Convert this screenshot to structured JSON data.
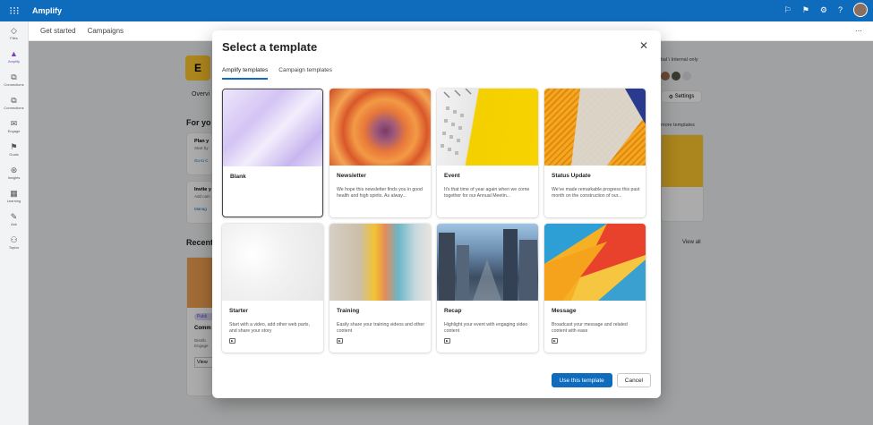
{
  "app": {
    "title": "Amplify"
  },
  "rail": [
    {
      "label": "Files",
      "icon": "files-icon",
      "glyph": "◇"
    },
    {
      "label": "Amplify",
      "icon": "amplify-icon",
      "glyph": "▲"
    },
    {
      "label": "Connections",
      "icon": "connections-icon",
      "glyph": "⧉"
    },
    {
      "label": "Connections",
      "icon": "connections-icon",
      "glyph": "⧉"
    },
    {
      "label": "Engage",
      "icon": "engage-icon",
      "glyph": "✉"
    },
    {
      "label": "Goals",
      "icon": "goals-icon",
      "glyph": "⚑"
    },
    {
      "label": "Insights",
      "icon": "insights-icon",
      "glyph": "⊛"
    },
    {
      "label": "Learning",
      "icon": "learning-icon",
      "glyph": "▦"
    },
    {
      "label": "Ask",
      "icon": "ask-icon",
      "glyph": "✎"
    },
    {
      "label": "Topics",
      "icon": "topics-icon",
      "glyph": "⚇"
    }
  ],
  "subbar": {
    "items": [
      "Get started",
      "Campaigns"
    ]
  },
  "background": {
    "logo_letter": "E",
    "tab": "Overvi",
    "for_you": "For yo",
    "plan": "Plan y",
    "start": "Start by",
    "goto": "Go to C",
    "invite": "Invite y",
    "add": "Add cam",
    "manage": "Manag",
    "recent": "Recent",
    "internal": "tial \\ Internal only",
    "settings": "Settings",
    "more_templates": "more templates",
    "view_all": "View all",
    "publ": "Publi",
    "comm": "Comm",
    "view": "View",
    "distrib": "Distrib",
    "engage": "Engage"
  },
  "modal": {
    "title": "Select a template",
    "tabs": [
      "Amplify templates",
      "Campaign templates"
    ],
    "templates": [
      {
        "title": "Blank",
        "desc": "",
        "video": false
      },
      {
        "title": "Newsletter",
        "desc": "We hope this newsletter finds you in good health and high spirits. As alway...",
        "video": false
      },
      {
        "title": "Event",
        "desc": "It's that time of year again when we come together for our Annual Meetin...",
        "video": false
      },
      {
        "title": "Status Update",
        "desc": "We've made remarkable progress this past month on the construction of our...",
        "video": false
      },
      {
        "title": "Starter",
        "desc": "Start with a video, add other web parts, and share your story",
        "video": true
      },
      {
        "title": "Training",
        "desc": "Easily share your training videos and other content",
        "video": true
      },
      {
        "title": "Recap",
        "desc": "Highlight your event with engaging video content",
        "video": true
      },
      {
        "title": "Message",
        "desc": "Broadcast your message and related content with ease",
        "video": true
      }
    ],
    "primary_button": "Use this template",
    "cancel_button": "Cancel"
  },
  "colors": {
    "accent": "#0f6cbd",
    "topbar": "#0f6cbd"
  }
}
